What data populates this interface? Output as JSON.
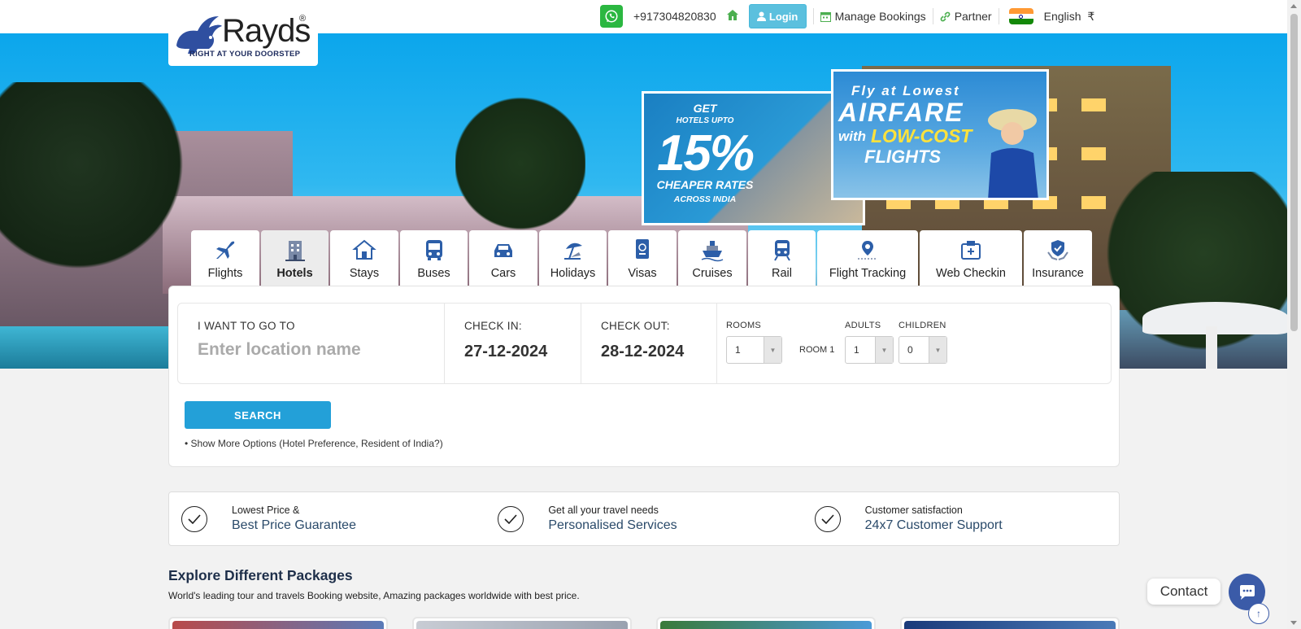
{
  "logo": {
    "brand": "Rayds",
    "reg": "®",
    "tagline": "RIGHT AT YOUR DOORSTEP"
  },
  "topnav": {
    "phone": "+917304820830",
    "login": "Login",
    "manage": "Manage Bookings",
    "partner": "Partner",
    "language": "English",
    "currency": "₹"
  },
  "promo1": {
    "l1": "GET",
    "l2": "HOTELS UPTO",
    "l3": "15%",
    "l4": "CHEAPER RATES",
    "l5": "ACROSS INDIA"
  },
  "promo2": {
    "l1": "Fly at Lowest",
    "l2": "AIRFARE",
    "l3a": "with",
    "l3b": "LOW-COST",
    "l4": "FLIGHTS"
  },
  "tabs": [
    {
      "label": "Flights",
      "icon": "plane-icon"
    },
    {
      "label": "Hotels",
      "icon": "hotel-icon"
    },
    {
      "label": "Stays",
      "icon": "house-icon"
    },
    {
      "label": "Buses",
      "icon": "bus-icon"
    },
    {
      "label": "Cars",
      "icon": "car-icon"
    },
    {
      "label": "Holidays",
      "icon": "beach-umbrella-icon"
    },
    {
      "label": "Visas",
      "icon": "passport-icon"
    },
    {
      "label": "Cruises",
      "icon": "ship-icon"
    },
    {
      "label": "Rail",
      "icon": "train-icon"
    },
    {
      "label": "Flight Tracking",
      "icon": "location-pin-icon"
    },
    {
      "label": "Web Checkin",
      "icon": "boarding-pass-icon"
    },
    {
      "label": "Insurance",
      "icon": "shield-hands-icon"
    }
  ],
  "search": {
    "dest_label": "I WANT TO GO TO",
    "dest_placeholder": "Enter location name",
    "checkin_label": "CHECK IN:",
    "checkin_value": "27-12-2024",
    "checkout_label": "CHECK OUT:",
    "checkout_value": "28-12-2024",
    "rooms_label": "ROOMS",
    "rooms_value": "1",
    "room1_label": "ROOM 1",
    "adults_label": "ADULTS",
    "adults_value": "1",
    "children_label": "CHILDREN",
    "children_value": "0",
    "search_button": "SEARCH",
    "more_options": "• Show More Options (Hotel Preference, Resident of India?)"
  },
  "features": [
    {
      "l1": "Lowest Price &",
      "l2": "Best Price Guarantee"
    },
    {
      "l1": "Get all your travel needs",
      "l2": "Personalised Services"
    },
    {
      "l1": "Customer satisfaction",
      "l2": "24x7 Customer Support"
    }
  ],
  "explore": {
    "title": "Explore Different Packages",
    "subtitle": "World's leading tour and travels Booking website, Amazing packages worldwide with best price."
  },
  "contact": {
    "label": "Contact"
  },
  "colors": {
    "accent": "#23a0d8",
    "login": "#5bc0de",
    "whatsapp": "#2bb741",
    "chat": "#3b5ba8"
  }
}
